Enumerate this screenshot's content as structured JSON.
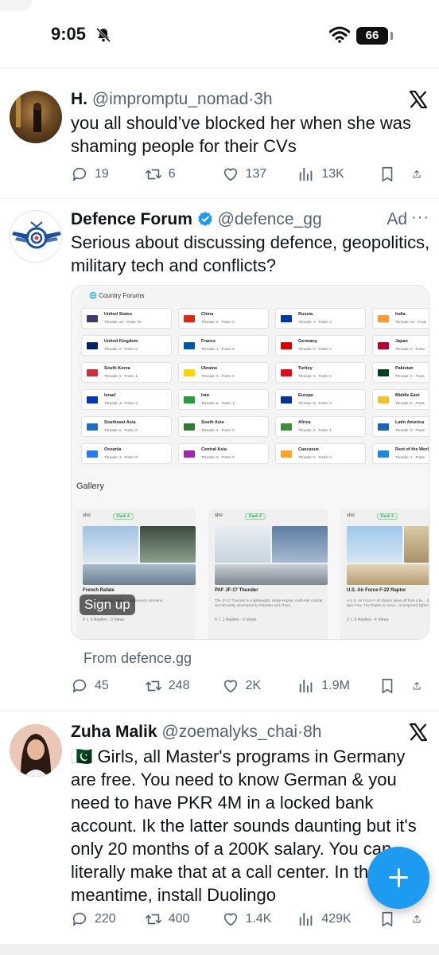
{
  "status_bar": {
    "time": "9:05",
    "battery": "66"
  },
  "tweets": [
    {
      "name": "H.",
      "handle": "@impromptu_nomad",
      "sep": "·",
      "time": "3h",
      "text": "you all should’ve blocked her when she was shaming people for their CVs",
      "replies": "19",
      "retweets": "6",
      "likes": "137",
      "views": "13K"
    },
    {
      "name": "Defence Forum",
      "handle": "@defence_gg",
      "ad": "Ad",
      "more": "···",
      "text": "Serious about discussing defence, geopolitics, military tech and conflicts?",
      "from": "From defence.gg",
      "replies": "45",
      "retweets": "248",
      "likes": "2K",
      "views": "1.9M",
      "card": {
        "section_title": "Country Forums",
        "countries": [
          {
            "name": "United States",
            "stats": "Threads: 22 · Posts: 34",
            "color": "#3c3b6e"
          },
          {
            "name": "China",
            "stats": "Threads: 6 · Posts: 5",
            "color": "#de2910"
          },
          {
            "name": "Russia",
            "stats": "Threads: 7 · Posts: 3",
            "color": "#0039a6"
          },
          {
            "name": "India",
            "stats": "Threads: 32 · Posts",
            "color": "#ff9933"
          },
          {
            "name": "United Kingdom",
            "stats": "Threads: 0 · Posts: 0",
            "color": "#012169"
          },
          {
            "name": "France",
            "stats": "Threads: 1 · Posts: 0",
            "color": "#0055a4"
          },
          {
            "name": "Germany",
            "stats": "Threads: 0 · Posts: 0",
            "color": "#dd0000"
          },
          {
            "name": "Japan",
            "stats": "Threads: 0 · Posts",
            "color": "#bc002d"
          },
          {
            "name": "South Korea",
            "stats": "Threads: 2 · Posts: 1",
            "color": "#cd2e3a"
          },
          {
            "name": "Ukraine",
            "stats": "Threads: 0 · Posts: 0",
            "color": "#ffd500"
          },
          {
            "name": "Turkey",
            "stats": "Threads: 1 · Posts: 0",
            "color": "#e30a17"
          },
          {
            "name": "Pakistan",
            "stats": "Threads: 0 · Posts",
            "color": "#01411c"
          },
          {
            "name": "Israel",
            "stats": "Threads: 3 · Posts: 3",
            "color": "#0038b8"
          },
          {
            "name": "Iran",
            "stats": "Threads: 8 · Posts: 1",
            "color": "#239f40"
          },
          {
            "name": "Europe",
            "stats": "Threads: 0 · Posts: 0",
            "color": "#003399"
          },
          {
            "name": "Middle East",
            "stats": "Threads: 0 · Posts",
            "color": "#f2c230"
          },
          {
            "name": "Southeast Asia",
            "stats": "Threads: 5 · Posts: 0",
            "color": "#1f6fbf"
          },
          {
            "name": "South Asia",
            "stats": "Threads: 2 · Posts: 0",
            "color": "#2e7d32"
          },
          {
            "name": "Africa",
            "stats": "Threads: 2 · Posts: 1",
            "color": "#3a8f3a"
          },
          {
            "name": "Latin America",
            "stats": "Threads: 0 · Posts",
            "color": "#1565c0"
          },
          {
            "name": "Oceania",
            "stats": "Threads: 1 · Posts: 0",
            "color": "#2979ff"
          },
          {
            "name": "Central Asia",
            "stats": "Threads: 0 · Posts: 0",
            "color": "#9c27b0"
          },
          {
            "name": "Caucasus",
            "stats": "Threads: 0 · Posts: 0",
            "color": "#f9a825"
          },
          {
            "name": "Rest of the World",
            "stats": "Threads: 1 · Posts",
            "color": "#1e88e5"
          }
        ],
        "gallery_title": "Gallery",
        "gallery": [
          {
            "user": "sho",
            "rank": "Rank 4",
            "title": "French Rafale",
            "desc": "...ting an superiority, strike, ...nnaissance missions.",
            "stats": "0 ⇩ 0 Replies · 0 Views"
          },
          {
            "user": "sho",
            "rank": "Rank 4",
            "title": "PAF JF-17 Thunder",
            "desc": "The JF-17 Thunder is a lightweight, single-engine, multi-role combat aircraft jointly developed by Pakistan and China.",
            "stats": "0 ⇩ 1 Replies · 6 Views"
          },
          {
            "user": "sho",
            "rank": "Rank 4",
            "title": "U.S. Air Force F-22 Raptor",
            "desc": "A U.S. Air Force F-22 Raptor takes off from a bu... during Operation Epic Fury. The Raptor is unma... or projected fighter aircraft.",
            "stats": "3 ⇩ 0 Replies · 4 Views"
          }
        ],
        "signup": "Sign up"
      }
    },
    {
      "name": "Zuha Malik",
      "handle": "@zoemalyks_chai",
      "sep": "·",
      "time": "8h",
      "text": "🇵🇰 Girls, all Master's programs in Germany are free. You need to know German & you need to have PKR 4M in a locked bank account. Ik the latter sounds daunting but it's only 20 months of a 200K salary. You can literally make that at a call center. In the meantime, install Duolingo",
      "replies": "220",
      "retweets": "400",
      "likes": "1.4K",
      "views": "429K"
    }
  ]
}
